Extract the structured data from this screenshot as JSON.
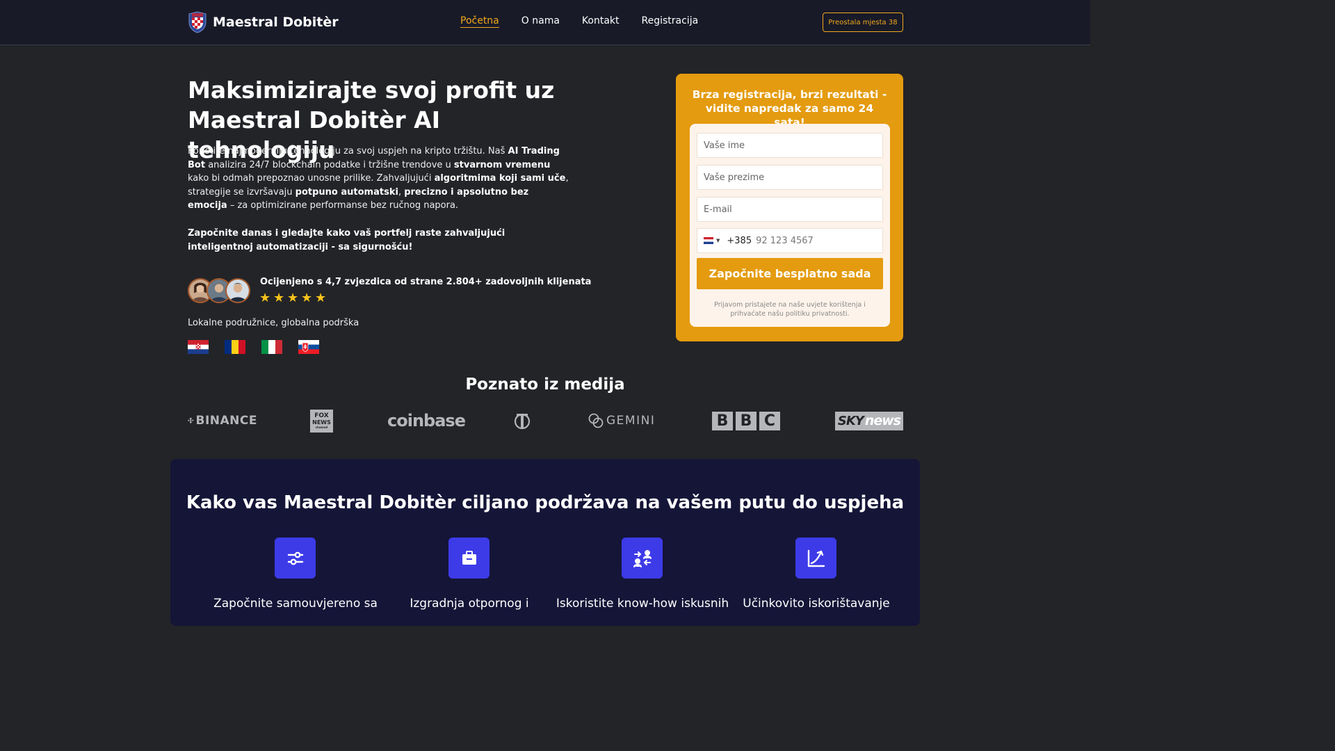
{
  "header": {
    "brand": "Maestral Dobitèr",
    "nav": [
      {
        "label": "Početna",
        "active": true
      },
      {
        "label": "O nama",
        "active": false
      },
      {
        "label": "Kontakt",
        "active": false
      },
      {
        "label": "Registracija",
        "active": false
      }
    ],
    "seats_label": "Preostala mjesta 38",
    "logo_icon": "croatia-shield-icon"
  },
  "hero": {
    "title": "Maksimizirajte svoj profit uz Maestral Dobitèr AI tehnologiju",
    "paragraph": [
      {
        "t": "Koristite najmoderniju tehnologiju za svoj uspjeh na kripto tržištu. Naš ",
        "b": false
      },
      {
        "t": "AI Trading Bot",
        "b": true
      },
      {
        "t": " analizira 24/7 blockchain podatke i tržišne trendove u ",
        "b": false
      },
      {
        "t": "stvarnom vremenu",
        "b": true
      },
      {
        "t": " kako bi odmah prepoznao unosne prilike. Zahvaljujući ",
        "b": false
      },
      {
        "t": "algoritmima koji sami uče",
        "b": true
      },
      {
        "t": ", strategije se izvršavaju ",
        "b": false
      },
      {
        "t": "potpuno automatski",
        "b": true
      },
      {
        "t": ", ",
        "b": false
      },
      {
        "t": "precizno i apsolutno bez emocija",
        "b": true
      },
      {
        "t": " – za optimizirane performanse bez ručnog napora.",
        "b": false
      }
    ],
    "cta_text": "Započnite danas i gledajte kako vaš portfelj raste zahvaljujući inteligentnoj automatizaciji - sa sigurnošću!",
    "rating_text": "Ocijenjeno s 4,7 zvjezdica od strane 2.804+ zadovoljnih klijenata",
    "stars": 5,
    "local_text": "Lokalne podružnice, globalna podrška",
    "flags": [
      "croatia-flag-icon",
      "romania-flag-icon",
      "italy-flag-icon",
      "slovakia-flag-icon"
    ]
  },
  "registration": {
    "title": "Brza registracija, brzi rezultati - vidite napredak za samo 24 sata!",
    "first_name_placeholder": "Vaše ime",
    "last_name_placeholder": "Vaše prezime",
    "email_placeholder": "E-mail",
    "phone_code": "+385",
    "phone_placeholder": "92 123 4567",
    "submit_label": "Započnite besplatno sada",
    "disclaimer": "Prijavom pristajete na naše uvjete korištenja i prihvaćate našu politiku privatnosti."
  },
  "media": {
    "title": "Poznato iz medija",
    "logos": [
      "binance-logo",
      "fox-news-logo",
      "coinbase-logo",
      "nyt-logo",
      "gemini-logo",
      "bbc-logo",
      "sky-news-logo"
    ],
    "binance_label": "BINANCE",
    "fox_top": "FOX",
    "fox_bottom": "NEWS",
    "fox_sub": "channel",
    "coinbase_label": "coinbase",
    "gemini_label": "GEMINI",
    "bbc_letters": [
      "B",
      "B",
      "C"
    ],
    "sky_label": "SKY",
    "sky_news_label": "news"
  },
  "features": {
    "title": "Kako vas Maestral Dobitèr ciljano podržava na vašem putu do uspjeha",
    "items": [
      {
        "label": "Započnite samouvjereno sa",
        "icon": "sliders-icon"
      },
      {
        "label": "Izgradnja otpornog i",
        "icon": "briefcase-icon"
      },
      {
        "label": "Iskoristite know-how iskusnih",
        "icon": "user-exchange-icon"
      },
      {
        "label": "Učinkovito iskorištavanje",
        "icon": "growth-chart-icon"
      }
    ]
  },
  "colors": {
    "accent": "#f2a81d",
    "card": "#e49b0f",
    "feature_icon_bg": "#3d3be8",
    "header_bg": "#181a28",
    "page_bg": "#232428",
    "features_bg": "#151538"
  }
}
